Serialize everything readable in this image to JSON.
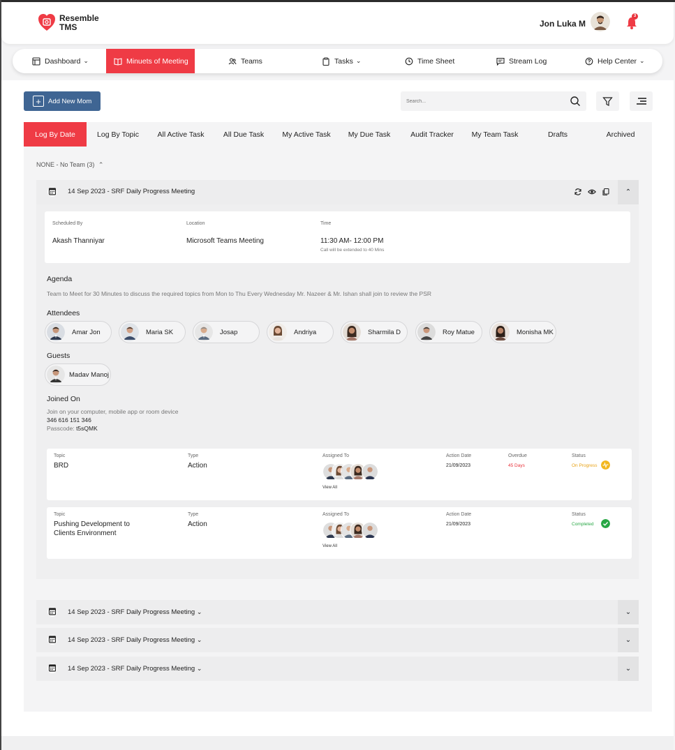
{
  "brand": {
    "line1": "Resemble",
    "line2": "TMS"
  },
  "user": {
    "name": "Jon Luka M",
    "notifications": "3"
  },
  "nav": {
    "dashboard": "Dashboard",
    "mom": "Minuets of Meeting",
    "teams": "Teams",
    "tasks": "Tasks",
    "timesheet": "Time Sheet",
    "streamlog": "Stream Log",
    "help": "Help Center"
  },
  "toolbar": {
    "add_label": "Add New Mom",
    "search_placeholder": "Search..."
  },
  "tabs": [
    "Log By Date",
    "Log By Topic",
    "All Active Task",
    "All Due Task",
    "My Active Task",
    "My Due Task",
    "Audit Tracker",
    "My Team Task",
    "Drafts",
    "Archived"
  ],
  "group": {
    "label": "NONE - No Team (3)"
  },
  "meeting": {
    "title": "14 Sep 2023 - SRF Daily Progress Meeting",
    "scheduled_by_label": "Scheduled By",
    "scheduled_by": "Akash Thanniyar",
    "location_label": "Location",
    "location": "Microsoft Teams Meeting",
    "time_label": "Time",
    "time": "11:30 AM- 12:00 PM",
    "time_note": "Call will be extended to 40 Mins",
    "agenda_title": "Agenda",
    "agenda": "Team to Meet for 30 Minutes to discuss the required topics from Mon to Thu  Every Wednesday Mr. Nazeer & Mr. Ishan shall join to review the PSR",
    "attendees_title": "Attendees",
    "attendees": [
      "Amar Jon",
      "Maria SK",
      "Josap",
      "Andriya",
      "Sharmila D",
      "Roy Matue",
      "Monisha MK"
    ],
    "guests_title": "Guests",
    "guests": [
      "Madav Manoj"
    ],
    "joined_title": "Joined On",
    "joined_text": "Join on your computer, mobile app or room device",
    "meeting_id": "346 616 151 346",
    "passcode_label": "Passcode: ",
    "passcode": "t5sQMK"
  },
  "task_labels": {
    "topic": "Topic",
    "type": "Type",
    "assigned": "Assigned To",
    "action_date": "Action Date",
    "overdue": "Overdue",
    "status": "Status",
    "view_all": "View All"
  },
  "tasks": [
    {
      "topic": "BRD",
      "type": "Action",
      "action_date": "21/09/2023",
      "overdue": "45 Days",
      "status": "On Progress"
    },
    {
      "topic_line1": "Pushing Development to",
      "topic_line2": "Clients Environment",
      "type": "Action",
      "action_date": "21/09/2023",
      "status": "Completed"
    }
  ],
  "other_meetings": [
    "14 Sep 2023 - SRF Daily Progress Meeting",
    "14 Sep 2023 - SRF Daily Progress Meeting",
    "14 Sep 2023 - SRF Daily Progress Meeting"
  ],
  "colors": {
    "accent": "#ef3b45",
    "primary_button": "#3f6593",
    "on_progress": "#e8a317",
    "completed": "#28a745"
  }
}
